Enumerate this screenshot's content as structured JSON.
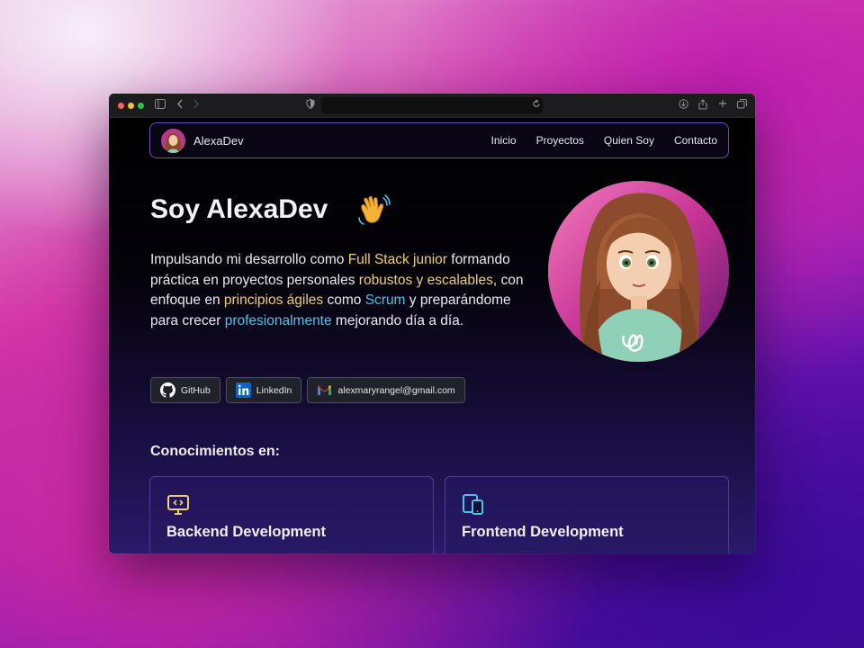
{
  "browser": {
    "address": ""
  },
  "nav": {
    "brand": "AlexaDev",
    "links": [
      "Inicio",
      "Proyectos",
      "Quien Soy",
      "Contacto"
    ]
  },
  "hero": {
    "title": "Soy AlexaDev",
    "wave_emoji": "👋",
    "text_parts": [
      {
        "t": "Impulsando mi desarrollo como ",
        "c": "plain"
      },
      {
        "t": "Full Stack junior",
        "c": "yellow"
      },
      {
        "t": " formando práctica en proyectos personales ",
        "c": "plain"
      },
      {
        "t": "robustos y escalables",
        "c": "yellow"
      },
      {
        "t": ", con enfoque en ",
        "c": "plain"
      },
      {
        "t": "principios ágiles",
        "c": "yellow"
      },
      {
        "t": " como ",
        "c": "plain"
      },
      {
        "t": "Scrum",
        "c": "blue"
      },
      {
        "t": " y preparándome para crecer ",
        "c": "plain"
      },
      {
        "t": "profesionalmente",
        "c": "blue"
      },
      {
        "t": " mejorando día a día.",
        "c": "plain"
      }
    ]
  },
  "social": {
    "github_label": "GitHub",
    "linkedin_label": "LinkedIn",
    "email_label": "alexmaryrangel@gmail.com"
  },
  "skills": {
    "section_title": "Conocimientos en:",
    "cards": [
      {
        "title": "Backend Development",
        "icon": "monitor-code-icon"
      },
      {
        "title": "Frontend Development",
        "icon": "devices-icon"
      }
    ]
  },
  "colors": {
    "accent_yellow": "#f1cf6e",
    "accent_blue": "#4cc3e6",
    "border_purple": "#6a4fb8"
  }
}
